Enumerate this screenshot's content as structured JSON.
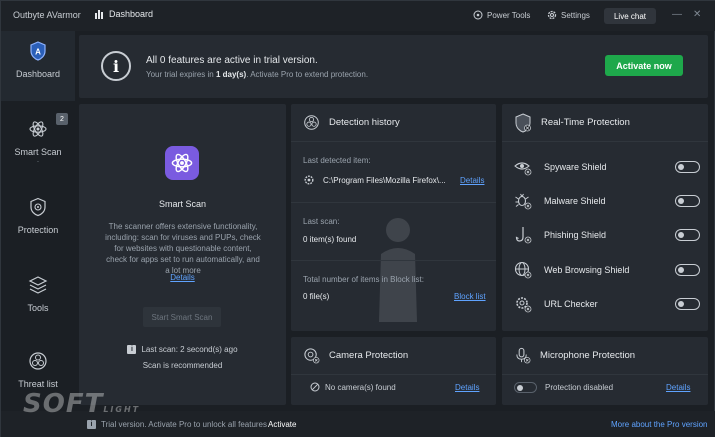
{
  "titlebar": {
    "app_name": "Outbyte AVarmor",
    "dashboard_tab": "Dashboard",
    "power_tools": "Power Tools",
    "settings": "Settings",
    "live_chat": "Live chat",
    "minimize": "—",
    "close": "✕"
  },
  "sidebar": {
    "items": [
      {
        "label": "Dashboard",
        "icon": "shield-a-icon"
      },
      {
        "label": "Smart Scan",
        "icon": "atom-icon",
        "badge": "2"
      },
      {
        "label": "Protection",
        "icon": "protection-icon"
      },
      {
        "label": "Tools",
        "icon": "layers-icon"
      },
      {
        "label": "Threat list",
        "icon": "biohazard-icon"
      }
    ],
    "smart_scan_dot": "."
  },
  "banner": {
    "title": "All 0 features are active in trial version.",
    "subtitle_pre": "Your trial expires in ",
    "subtitle_bold": "1 day(s)",
    "subtitle_post": ". Activate Pro to extend protection.",
    "activate_button": "Activate now",
    "info_glyph": "i"
  },
  "smart_scan": {
    "title": "Smart Scan",
    "description": "The scanner offers extensive functionality, including: scan for viruses and PUPs, check for websites with questionable content, check for apps set to run automatically, and a lot more",
    "details_link": "Details",
    "start_button": "Start Smart Scan",
    "last_scan": "Last scan: 2 second(s) ago",
    "recommendation": "Scan is recommended"
  },
  "detection_history": {
    "title": "Detection history",
    "last_detected_label": "Last detected item:",
    "last_detected_value": "C:\\Program Files\\Mozilla Firefox\\...",
    "details_link": "Details",
    "last_scan_label": "Last scan:",
    "last_scan_value": "0 item(s) found",
    "block_list_label": "Total number of items in Block list:",
    "block_list_value": "0 file(s)",
    "block_list_link": "Block list"
  },
  "realtime_protection": {
    "title": "Real-Time Protection",
    "shields": [
      {
        "label": "Spyware Shield",
        "icon": "spyware-eye-icon",
        "enabled": false
      },
      {
        "label": "Malware Shield",
        "icon": "malware-bug-icon",
        "enabled": false
      },
      {
        "label": "Phishing Shield",
        "icon": "phishing-hook-icon",
        "enabled": false
      },
      {
        "label": "Web Browsing Shield",
        "icon": "globe-icon",
        "enabled": false
      },
      {
        "label": "URL Checker",
        "icon": "url-gear-icon",
        "enabled": false
      }
    ]
  },
  "camera_protection": {
    "title": "Camera Protection",
    "status": "No camera(s) found",
    "details_link": "Details"
  },
  "microphone_protection": {
    "title": "Microphone Protection",
    "status": "Protection disabled",
    "details_link": "Details"
  },
  "footer": {
    "trial_text": "Trial version. Activate Pro to unlock all features",
    "activate_link": "Activate",
    "more_link": "More about the Pro version"
  },
  "watermark": {
    "brand": "SOFT",
    "suffix": "LIGHT"
  },
  "colors": {
    "accent_green": "#1ea84b",
    "link_blue": "#5fa3ff",
    "smart_scan_purple": "#7a5be0",
    "background": "#1b1f24",
    "panel": "#262b32"
  }
}
